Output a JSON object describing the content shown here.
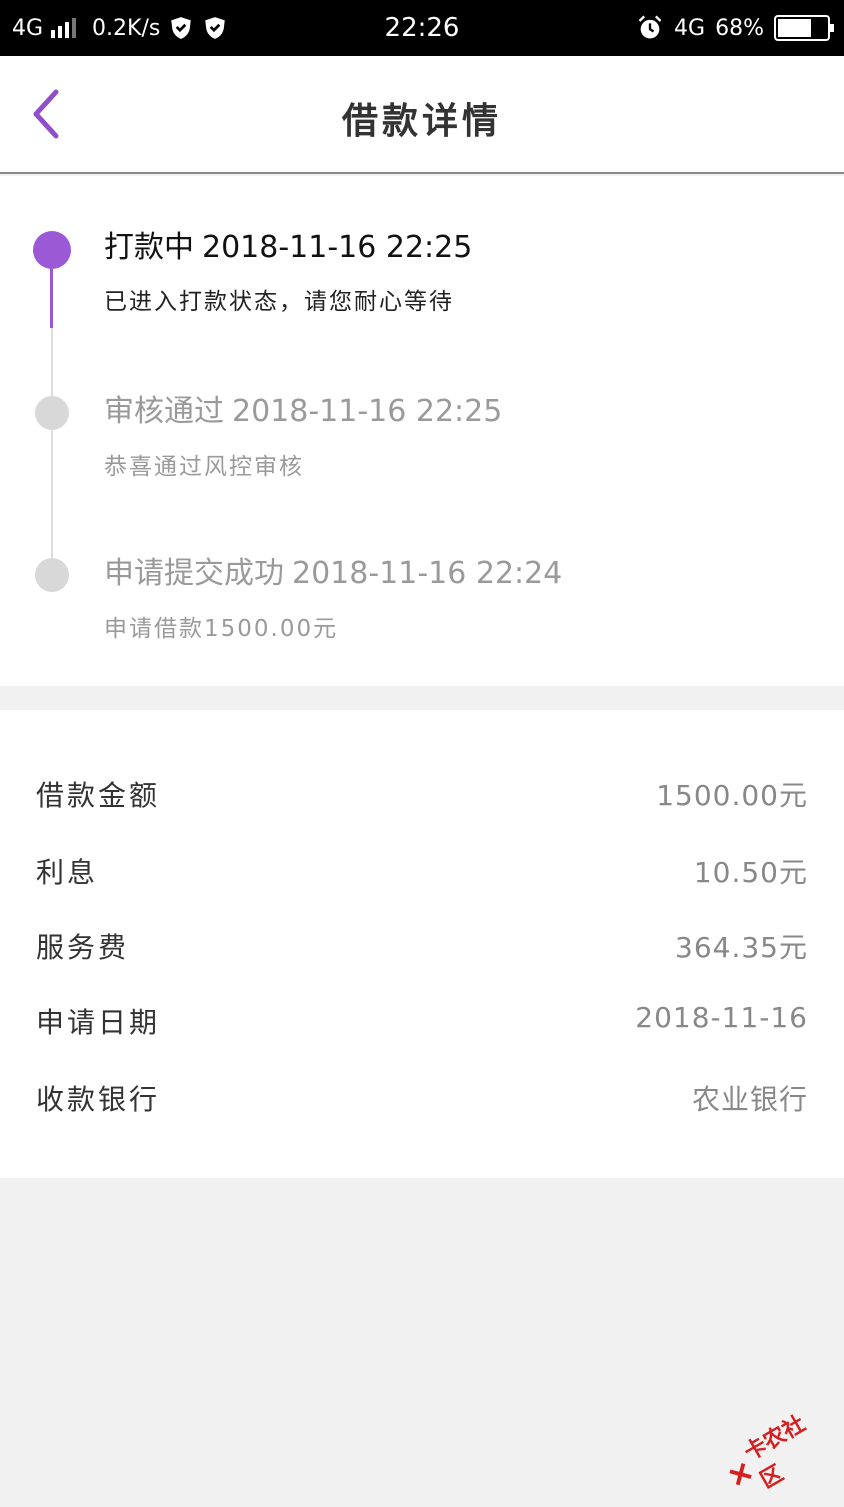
{
  "status_bar": {
    "network": "4G",
    "speed": "0.2K/s",
    "time": "22:26",
    "network2": "4G",
    "battery": "68%",
    "battery_level": 0.68
  },
  "header": {
    "title": "借款详情"
  },
  "timeline": [
    {
      "title": "打款中",
      "time": "2018-11-16 22:25",
      "desc": "已进入打款状态，请您耐心等待",
      "state": "active"
    },
    {
      "title": "审核通过",
      "time": "2018-11-16 22:25",
      "desc": "恭喜通过风控审核",
      "state": "done"
    },
    {
      "title": "申请提交成功",
      "time": "2018-11-16 22:24",
      "desc": "申请借款1500.00元",
      "state": "done"
    }
  ],
  "details": [
    {
      "label": "借款金额",
      "value": "1500.00元"
    },
    {
      "label": "利息",
      "value": "10.50元"
    },
    {
      "label": "服务费",
      "value": "364.35元"
    },
    {
      "label": "申请日期",
      "value": "2018-11-16"
    },
    {
      "label": "收款银行",
      "value": "农业银行"
    }
  ],
  "watermark": {
    "text": "卡农社区"
  },
  "colors": {
    "accent": "#9b59d6",
    "inactive_dot": "#d8d8d8"
  }
}
